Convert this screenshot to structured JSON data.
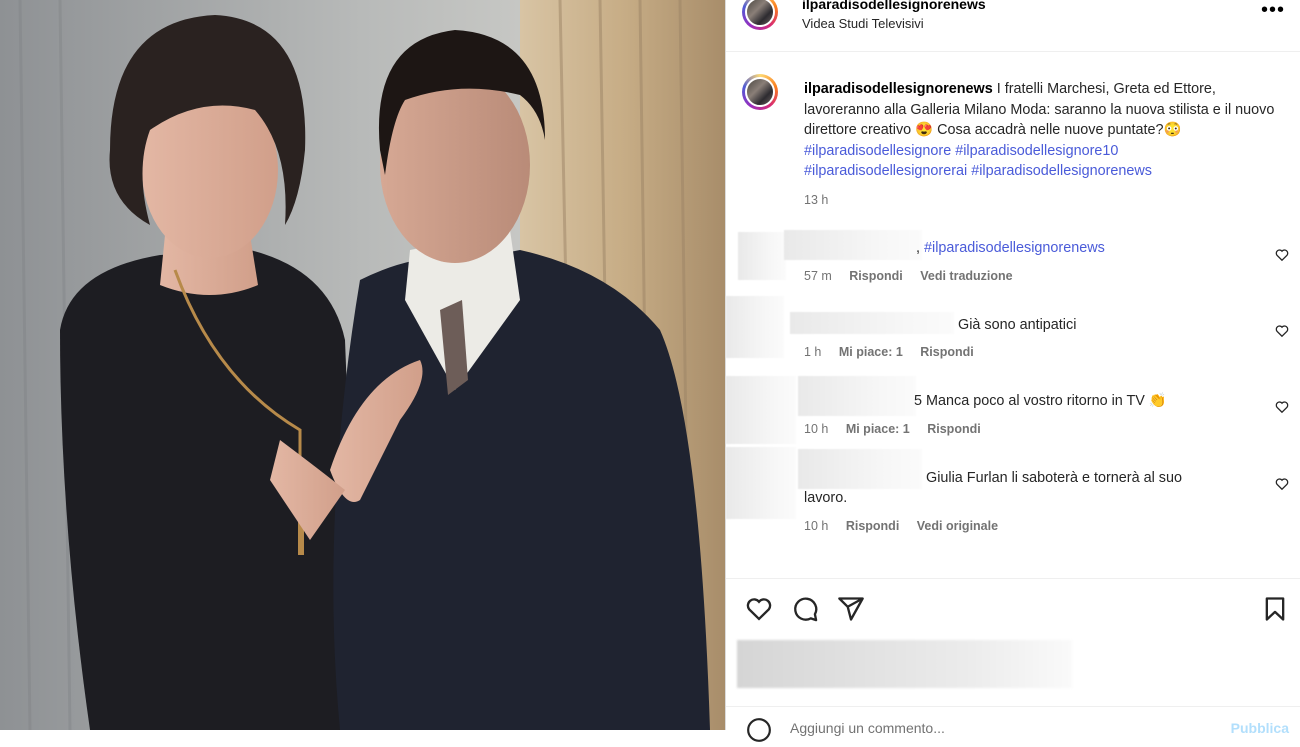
{
  "post": {
    "username": "ilparadisodellesignorenews",
    "location": "Videa Studi Televisivi",
    "more_icon": "more-horizontal-icon"
  },
  "caption": {
    "username": "ilparadisodellesignorenews",
    "text": " I fratelli Marchesi, Greta ed Ettore, lavoreranno alla Galleria Milano Moda: saranno la nuova stilista e il nuovo direttore creativo ",
    "emoji_1": "😍",
    "text_2": " Cosa accadrà nelle nuove puntate?",
    "emoji_2": "😳",
    "hashtags": [
      "#ilparadisodellesignore",
      "#ilparadisodellesignore10",
      "#ilparadisodellesignorerai",
      "#ilparadisodellesignorenews"
    ],
    "time": "13 h"
  },
  "comments": [
    {
      "text_prefix": ", ",
      "hashtag": "#ilparadisodellesignorenews",
      "time": "57 m",
      "likes": "",
      "reply": "Rispondi",
      "extra": "Vedi traduzione"
    },
    {
      "text": "Già sono antipatici",
      "time": "1 h",
      "likes": "Mi piace: 1",
      "reply": "Rispondi"
    },
    {
      "text": "5 Manca poco al vostro ritorno in TV 👏",
      "time": "10 h",
      "likes": "Mi piace: 1",
      "reply": "Rispondi"
    },
    {
      "text": "Giulia Furlan li saboterà e tornerà al suo",
      "text_2": "lavoro.",
      "time": "10 h",
      "reply": "Rispondi",
      "extra": "Vedi originale"
    }
  ],
  "actions": {
    "like_icon": "heart-icon",
    "comment_icon": "comment-icon",
    "share_icon": "share-icon",
    "save_icon": "bookmark-icon"
  },
  "add_comment": {
    "placeholder": "Aggiungi un commento...",
    "post_label": "Pubblica"
  }
}
